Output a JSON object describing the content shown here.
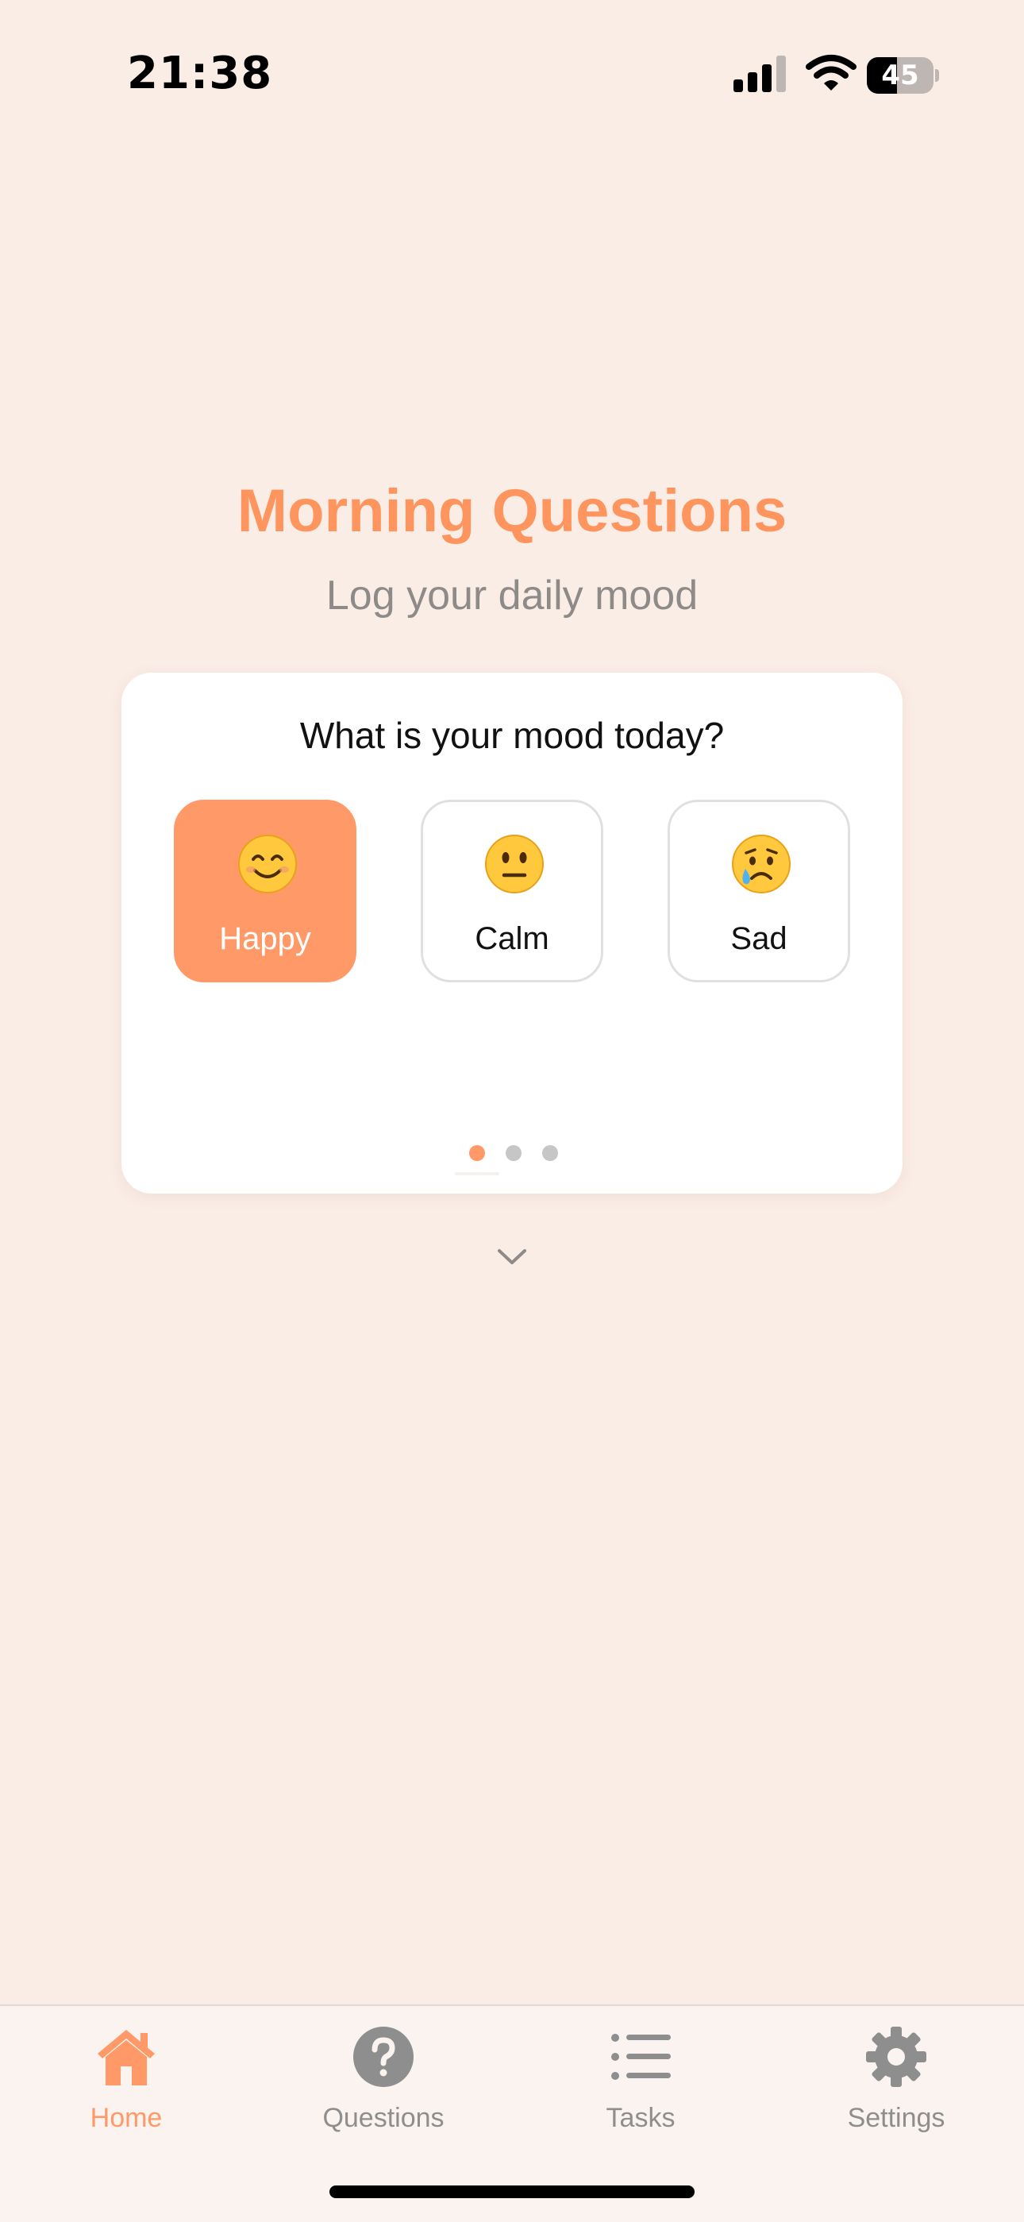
{
  "status_bar": {
    "time": "21:38",
    "battery_level": "45",
    "battery_fraction": 0.45,
    "icons": [
      "signal-icon",
      "wifi-icon",
      "battery-icon"
    ]
  },
  "header": {
    "title": "Morning Questions",
    "subtitle": "Log your daily mood"
  },
  "card": {
    "question": "What is your mood today?",
    "options": [
      {
        "label": "Happy",
        "icon": "smiling-face-emoji",
        "selected": true
      },
      {
        "label": "Calm",
        "icon": "neutral-face-emoji",
        "selected": false
      },
      {
        "label": "Sad",
        "icon": "crying-face-emoji",
        "selected": false
      }
    ],
    "pager": {
      "total": 3,
      "current": 1
    }
  },
  "tab_bar": {
    "items": [
      {
        "label": "Home",
        "icon": "house-icon",
        "active": true
      },
      {
        "label": "Questions",
        "icon": "question-mark-icon",
        "active": false
      },
      {
        "label": "Tasks",
        "icon": "list-icon",
        "active": false
      },
      {
        "label": "Settings",
        "icon": "gear-icon",
        "active": false
      }
    ]
  },
  "colors": {
    "accent": "#FF9A68",
    "background": "#FAEDE6",
    "title": "#FF955E",
    "inactive": "#8E8E8E"
  }
}
